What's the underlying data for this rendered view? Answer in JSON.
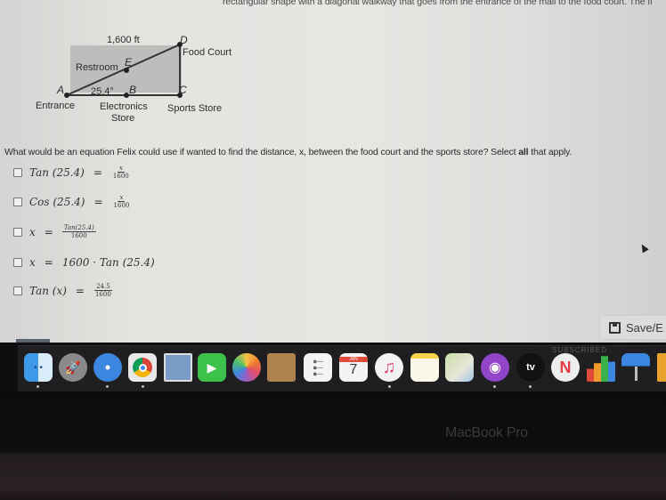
{
  "top_text": "rectangular shape with a diagonal walkway that goes from the entrance of the mall to the food court.  The fl",
  "diagram": {
    "dimension_label": "1,600 ft",
    "angle_label": "25.4°",
    "points": {
      "A": {
        "letter": "A",
        "name": "Entrance"
      },
      "B": {
        "letter": "B",
        "name": "Electronics Store",
        "name_line1": "Electronics",
        "name_line2": "Store"
      },
      "C": {
        "letter": "C",
        "name": "Sports Store"
      },
      "D": {
        "letter": "D",
        "name": "Food Court"
      },
      "E": {
        "letter": "E",
        "name": "Restroom"
      }
    }
  },
  "question": {
    "text_before": "What would be an equation Felix could use if wanted to find the distance, x, between the food court and the sports store? Select ",
    "emphasis": "all",
    "text_after": " that apply."
  },
  "options": [
    {
      "id": "opt1",
      "lhs": "Tan (25.4)",
      "eq": "=",
      "num": "x",
      "den": "1600",
      "checked": false
    },
    {
      "id": "opt2",
      "lhs": "Cos (25.4)",
      "eq": "=",
      "num": "x",
      "den": "1600",
      "checked": false
    },
    {
      "id": "opt3",
      "lhs": "x",
      "eq": "=",
      "num": "Tan(25.4)",
      "den": "1600",
      "checked": false
    },
    {
      "id": "opt4",
      "lhs": "x",
      "eq": "=",
      "rhs": "1600 · Tan (25.4)",
      "checked": false
    },
    {
      "id": "opt5",
      "lhs": "Tan (x)",
      "eq": "=",
      "num": "24.5",
      "den": "1600",
      "checked": false
    }
  ],
  "save_button": {
    "label": "Save/E",
    "icon": "floppy-disk-icon"
  },
  "dock": {
    "subscribe_text": "SUBSCRIBED",
    "apps": [
      {
        "name": "Finder",
        "icon": "finder-icon",
        "running": true
      },
      {
        "name": "Launchpad",
        "icon": "rocket-icon",
        "running": false
      },
      {
        "name": "Safari",
        "icon": "compass-icon",
        "running": true
      },
      {
        "name": "Google Chrome",
        "icon": "chrome-icon",
        "running": true
      },
      {
        "name": "Mail",
        "icon": "eagle-stamp-icon",
        "running": false
      },
      {
        "name": "FaceTime",
        "icon": "video-camera-icon",
        "running": false
      },
      {
        "name": "Photos",
        "icon": "flower-icon",
        "running": false
      },
      {
        "name": "Contacts",
        "icon": "address-book-icon",
        "running": false
      },
      {
        "name": "Reminders",
        "icon": "list-icon",
        "running": false
      },
      {
        "name": "Calendar",
        "icon": "calendar-icon",
        "month": "JAN",
        "day": "7",
        "running": false
      },
      {
        "name": "Music",
        "icon": "music-note-icon",
        "running": true
      },
      {
        "name": "Notes",
        "icon": "notepad-icon",
        "running": false
      },
      {
        "name": "Maps",
        "icon": "map-icon",
        "running": false
      },
      {
        "name": "Podcasts",
        "icon": "podcast-icon",
        "running": true
      },
      {
        "name": "TV",
        "icon": "apple-tv-icon",
        "label": "tv",
        "running": true
      },
      {
        "name": "News",
        "icon": "news-icon",
        "running": false
      },
      {
        "name": "Numbers",
        "icon": "bar-chart-icon",
        "running": false
      },
      {
        "name": "Keynote",
        "icon": "podium-icon",
        "running": false
      }
    ]
  },
  "bezel": {
    "brand": "MacBook Pro"
  }
}
